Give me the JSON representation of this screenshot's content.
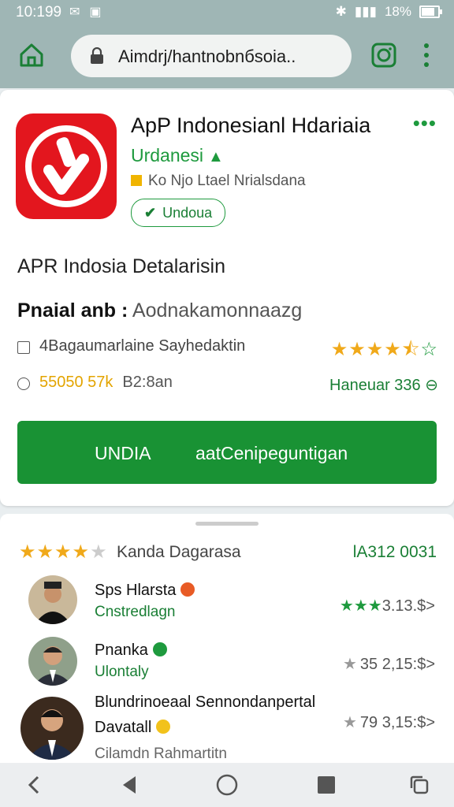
{
  "status": {
    "time": "10:199",
    "signal": "18%"
  },
  "browser": {
    "url": "Aimdrj/hantnobnбsoia.."
  },
  "app": {
    "title": "ApP Indonesianl Hdariaia",
    "developer": "Urdanesi",
    "subtitle": "Ko Njo Ltael Nrialsdana",
    "verified_label": "Undoua",
    "details_title": "APR Indosia Detalarisin",
    "detail_label": "Pnaial anb :",
    "detail_value": "Aodnakamonnaazg",
    "row1_text": "4Bagaumarlaine Sayhedaktin",
    "row1_rating": 4.5,
    "row2_number": "55050 57k",
    "row2_number2": "B2:8an",
    "row2_right": "Haneuar 336 ⊖",
    "install_left": "UNDIA",
    "install_right": "aatCenipeguntigan"
  },
  "reviews": {
    "header_label": "Kanda Dagarasa",
    "header_count": "lA312 0031",
    "rating": 4.5,
    "items": [
      {
        "name": "Sps Hlarsta",
        "sub": "Cnstredlagn",
        "meta": "3.13.$>",
        "stars": "★★★"
      },
      {
        "name": "Pnanka",
        "sub": "Ulontaly",
        "meta": "35 2,15:$>",
        "stars": "★"
      },
      {
        "name": "Blundrinoeaal Sennondanpertal",
        "name2": "Davatall",
        "sub": "Cilamdn Rahmartitn",
        "meta": "79 3,15:$>",
        "stars": "★"
      }
    ]
  },
  "colors": {
    "accent": "#199234",
    "brand_red": "#e3161e",
    "toolbar": "#9fb6b5"
  }
}
